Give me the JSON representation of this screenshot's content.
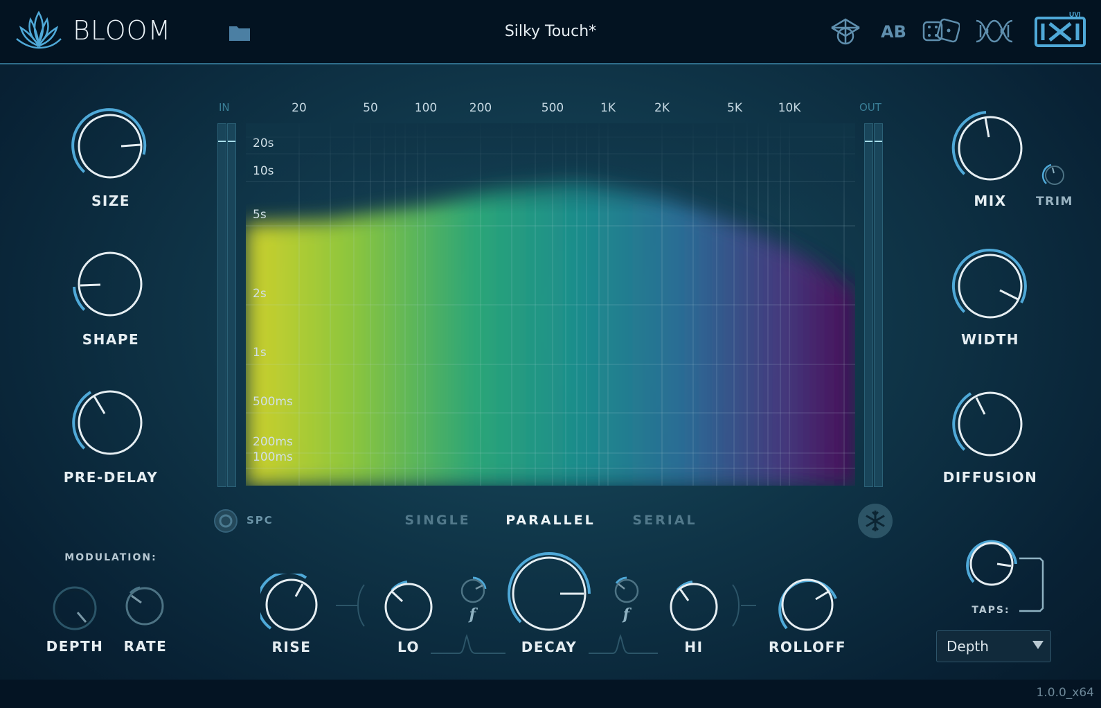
{
  "app": {
    "title": "BLOOM",
    "preset_name": "Silky Touch*",
    "version": "1.0.0_x64",
    "brand": "UVI"
  },
  "header": {
    "ab_label": "AB"
  },
  "left_knobs": [
    {
      "label": "SIZE"
    },
    {
      "label": "SHAPE"
    },
    {
      "label": "PRE-DELAY"
    }
  ],
  "modulation": {
    "label": "MODULATION:",
    "depth_label": "DEPTH",
    "rate_label": "RATE"
  },
  "right_knobs": {
    "mix": "MIX",
    "trim": "TRIM",
    "width": "WIDTH",
    "diffusion": "DIFFUSION",
    "taps": "TAPS:"
  },
  "graph": {
    "in_label": "IN",
    "out_label": "OUT",
    "freq_labels": [
      "20",
      "50",
      "100",
      "200",
      "500",
      "1K",
      "2K",
      "5K",
      "10K"
    ],
    "time_labels": [
      "20s",
      "10s",
      "5s",
      "2s",
      "1s",
      "500ms",
      "200ms",
      "100ms"
    ]
  },
  "modes": {
    "spc_label": "SPC",
    "single": "SINGLE",
    "parallel": "PARALLEL",
    "serial": "SERIAL",
    "active": "PARALLEL"
  },
  "bottom_knobs": {
    "rise": "RISE",
    "lo": "LO",
    "lo_freq": "f",
    "decay": "DECAY",
    "hi_freq": "f",
    "hi": "HI",
    "rolloff": "ROLLOFF"
  },
  "taps_dropdown": {
    "selected": "Depth"
  },
  "colors": {
    "accent": "#4fa9d8",
    "knob_ring": "#e6eef2",
    "background": "#0f3447"
  }
}
